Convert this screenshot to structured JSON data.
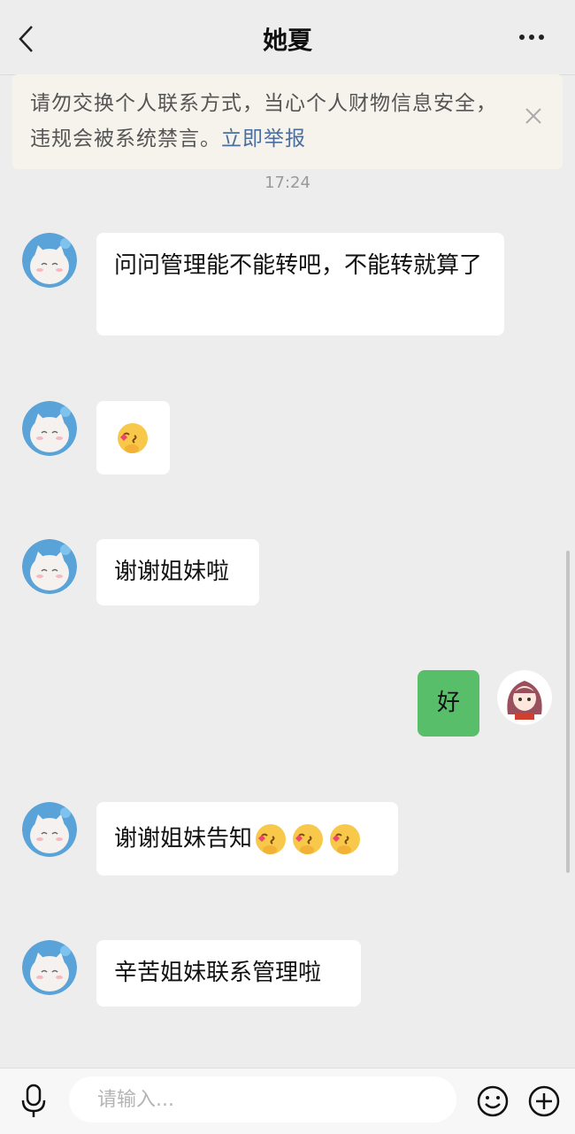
{
  "header": {
    "title": "她夏"
  },
  "notice": {
    "text": "请勿交换个人联系方式，当心个人财物信息安全，违规会被系统禁言。",
    "link": "立即举报"
  },
  "timestamp": "17:24",
  "messages": [
    {
      "text": "问问管理能不能转吧，不能转就算了"
    },
    {
      "emoji": "blowing-kiss-emoji"
    },
    {
      "text": "谢谢姐妹啦"
    },
    {
      "text": "好"
    },
    {
      "text": "谢谢姐妹告知",
      "emoji": "blowing-kiss-emoji"
    },
    {
      "text": "辛苦姐妹联系管理啦"
    }
  ],
  "input": {
    "placeholder": "请输入..."
  },
  "colors": {
    "background": "#ededed",
    "bubble_self": "#58be6a",
    "bubble_other": "#ffffff",
    "link": "#4a6e9e"
  }
}
